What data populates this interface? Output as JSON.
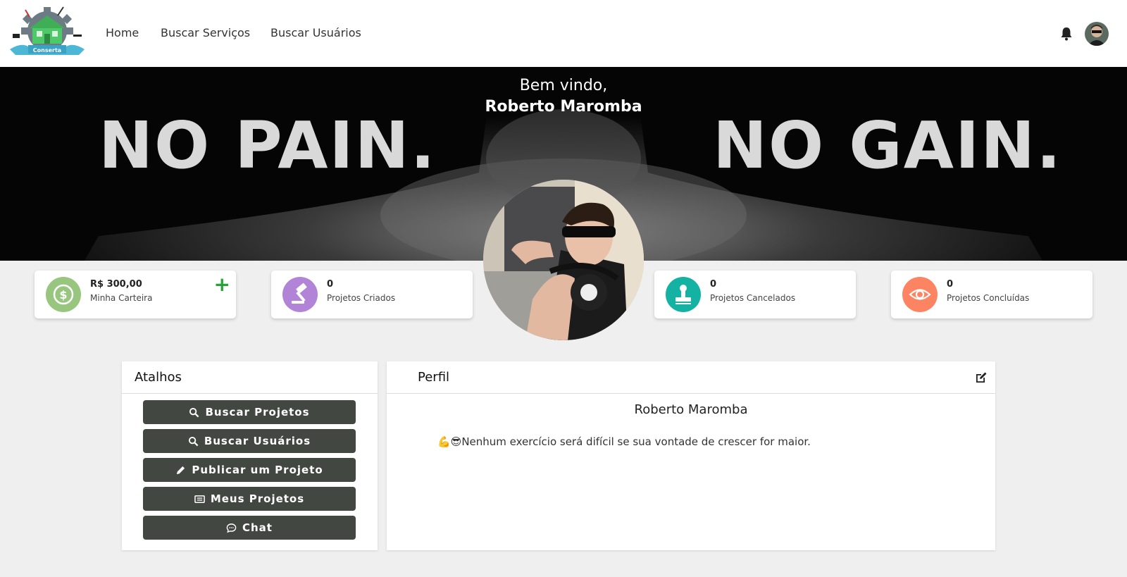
{
  "nav": {
    "logo_text": "Conserta",
    "links": [
      "Home",
      "Buscar Serviços",
      "Buscar Usuários"
    ]
  },
  "hero": {
    "greeting": "Bem vindo,",
    "user_name": "Roberto Maromba",
    "slogan_left": "NO PAIN.",
    "slogan_right": "NO GAIN."
  },
  "stats": [
    {
      "value": "R$ 300,00",
      "label": "Minha Carteira",
      "icon": "dollar-icon",
      "color": "#98c67e",
      "add": "+"
    },
    {
      "value": "0",
      "label": "Projetos Criados",
      "icon": "gavel-icon",
      "color": "#b184d8"
    },
    {
      "value": "0",
      "label": "Projetos Cancelados",
      "icon": "stamp-icon",
      "color": "#13b2a3"
    },
    {
      "value": "0",
      "label": "Projetos Concluídas",
      "icon": "eye-icon",
      "color": "#fd8462"
    }
  ],
  "shortcuts": {
    "title": "Atalhos",
    "buttons": [
      {
        "label": "Buscar Projetos",
        "icon": "search-icon"
      },
      {
        "label": "Buscar Usuários",
        "icon": "search-icon"
      },
      {
        "label": "Publicar um Projeto",
        "icon": "pencil-icon"
      },
      {
        "label": "Meus Projetos",
        "icon": "list-icon"
      },
      {
        "label": "Chat",
        "icon": "chat-icon"
      }
    ]
  },
  "profile": {
    "title": "Perfil",
    "name": "Roberto Maromba",
    "bio": "💪😎Nenhum exercício será difícil se sua vontade de crescer for maior."
  },
  "colors": {
    "button_bg": "#424841",
    "accent_green": "#23a33a"
  }
}
